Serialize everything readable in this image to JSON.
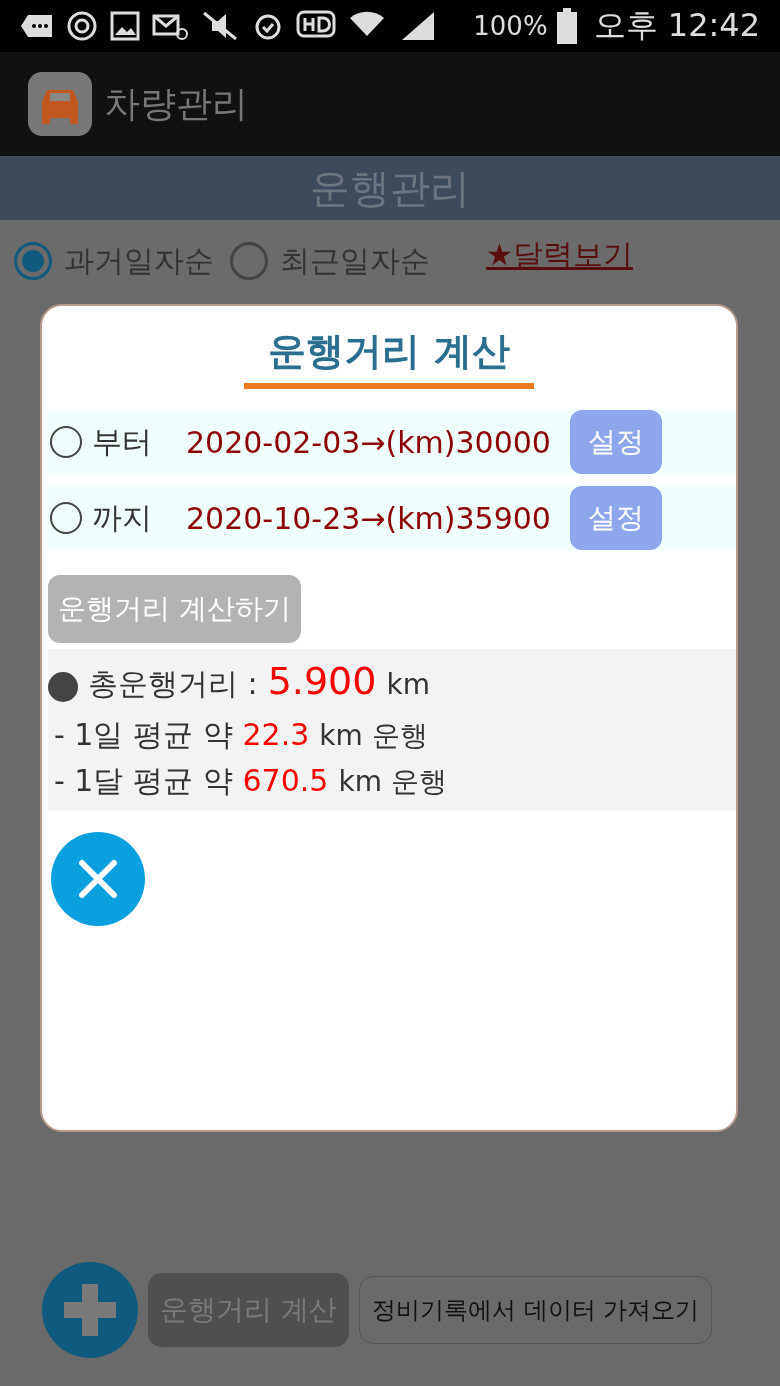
{
  "status_bar": {
    "battery": "100%",
    "time": "오후 12:42"
  },
  "app_bar": {
    "title": "차량관리"
  },
  "header": {
    "title": "운행관리"
  },
  "sort_options": [
    {
      "label": "과거일자순",
      "selected": true
    },
    {
      "label": "최근일자순",
      "selected": false
    }
  ],
  "calendar_link": "★달력보기",
  "dialog": {
    "title": "운행거리 계산",
    "range_rows": [
      {
        "label": "부터",
        "selected": false,
        "value": "2020-02-03→(km)30000",
        "button": "설정"
      },
      {
        "label": "까지",
        "selected": false,
        "value": "2020-10-23→(km)35900",
        "button": "설정"
      }
    ],
    "calculate_button": "운행거리 계산하기",
    "result": {
      "total_label": "총운행거리 :",
      "total_value": "5.900",
      "total_unit": "km",
      "lines": [
        {
          "prefix": "- 1일 평균 약",
          "value": "22.3",
          "suffix": "km 운행"
        },
        {
          "prefix": "- 1달 평균 약",
          "value": "670.5",
          "suffix": "km 운행"
        }
      ]
    }
  },
  "bottom_buttons": [
    {
      "kind": "filled",
      "label": "운행거리 계산"
    },
    {
      "kind": "outline",
      "label": "정비기록에서 데이터 가져오기"
    }
  ]
}
